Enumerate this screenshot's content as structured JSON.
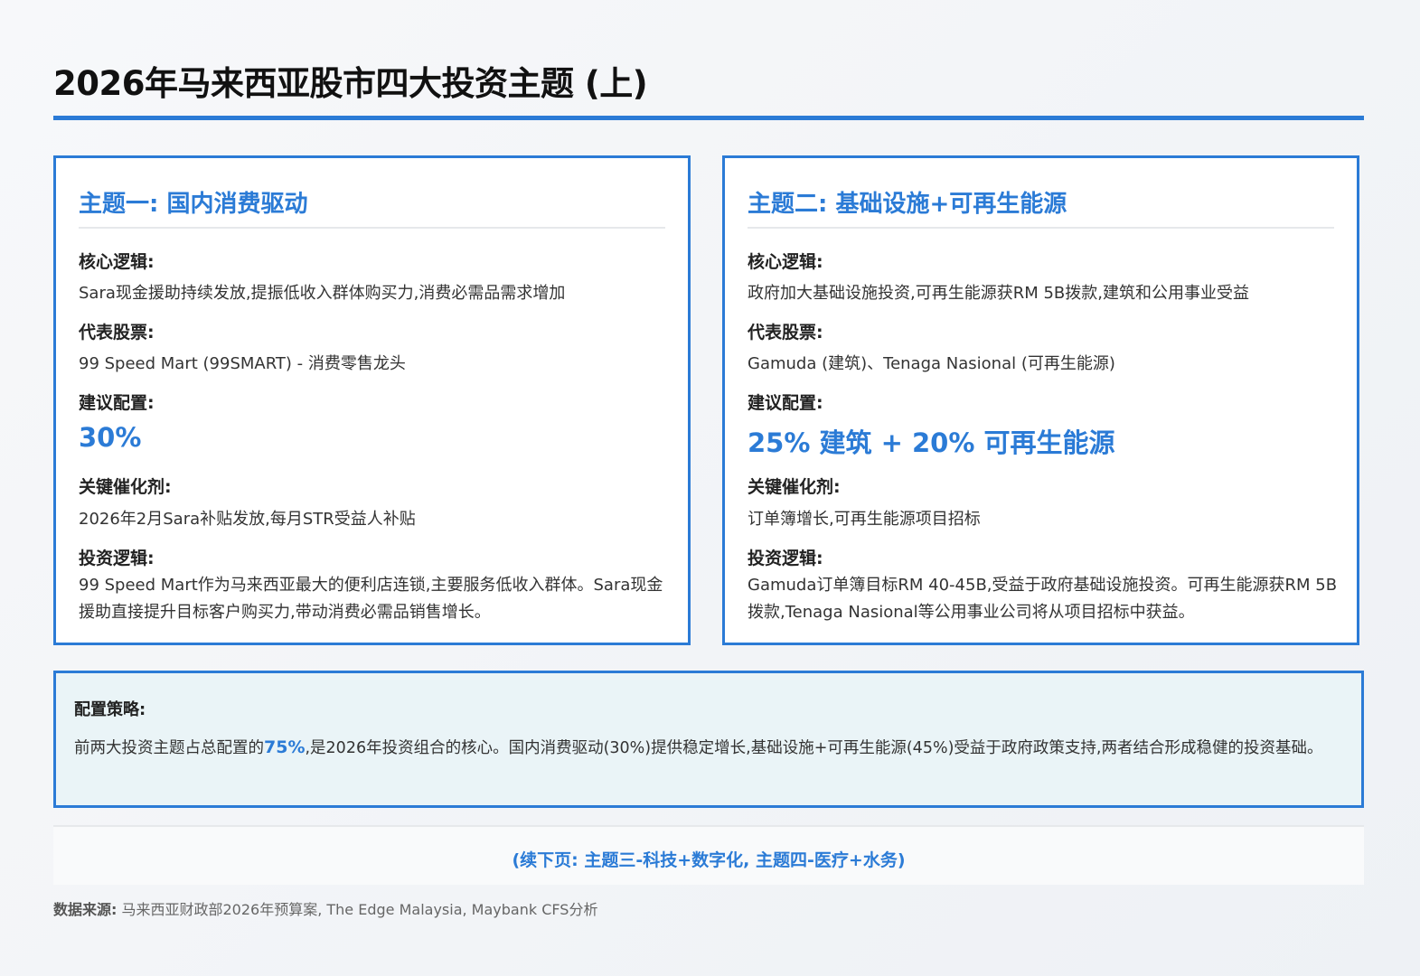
{
  "title": "2026年马来西亚股市四大投资主题 (上)",
  "themes": [
    {
      "title": "主题一: 国内消费驱动",
      "core_logic_label": "核心逻辑:",
      "core_logic": "Sara现金援助持续发放,提振低收入群体购买力,消费必需品需求增加",
      "stocks_label": "代表股票:",
      "stocks": "99 Speed Mart (99SMART) - 消费零售龙头",
      "allocation_label": "建议配置:",
      "allocation": "30%",
      "catalyst_label": "关键催化剂:",
      "catalyst": "2026年2月Sara补贴发放,每月STR受益人补贴",
      "thesis_label": "投资逻辑:",
      "thesis": "99 Speed Mart作为马来西亚最大的便利店连锁,主要服务低收入群体。Sara现金援助直接提升目标客户购买力,带动消费必需品销售增长。"
    },
    {
      "title": "主题二: 基础设施+可再生能源",
      "core_logic_label": "核心逻辑:",
      "core_logic": "政府加大基础设施投资,可再生能源获RM 5B拨款,建筑和公用事业受益",
      "stocks_label": "代表股票:",
      "stocks": "Gamuda (建筑)、Tenaga Nasional (可再生能源)",
      "allocation_label": "建议配置:",
      "allocation": "25% 建筑 + 20% 可再生能源",
      "catalyst_label": "关键催化剂:",
      "catalyst": "订单簿增长,可再生能源项目招标",
      "thesis_label": "投资逻辑:",
      "thesis": "Gamuda订单簿目标RM 40-45B,受益于政府基础设施投资。可再生能源获RM 5B拨款,Tenaga Nasional等公用事业公司将从项目招标中获益。"
    }
  ],
  "strategy": {
    "label": "配置策略:",
    "text_before": "前两大投资主题占总配置的",
    "highlight": "75%",
    "text_after": ",是2026年投资组合的核心。国内消费驱动(30%)提供稳定增长,基础设施+可再生能源(45%)受益于政府政策支持,两者结合形成稳健的投资基础。"
  },
  "continued": "(续下页: 主题三-科技+数字化, 主题四-医疗+水务)",
  "source": {
    "label": "数据来源:",
    "text": " 马来西亚财政部2026年预算案, The Edge Malaysia, Maybank CFS分析"
  },
  "colors": {
    "accent": "#2b7bd6",
    "strategy_bg": "#eaf4f7"
  }
}
